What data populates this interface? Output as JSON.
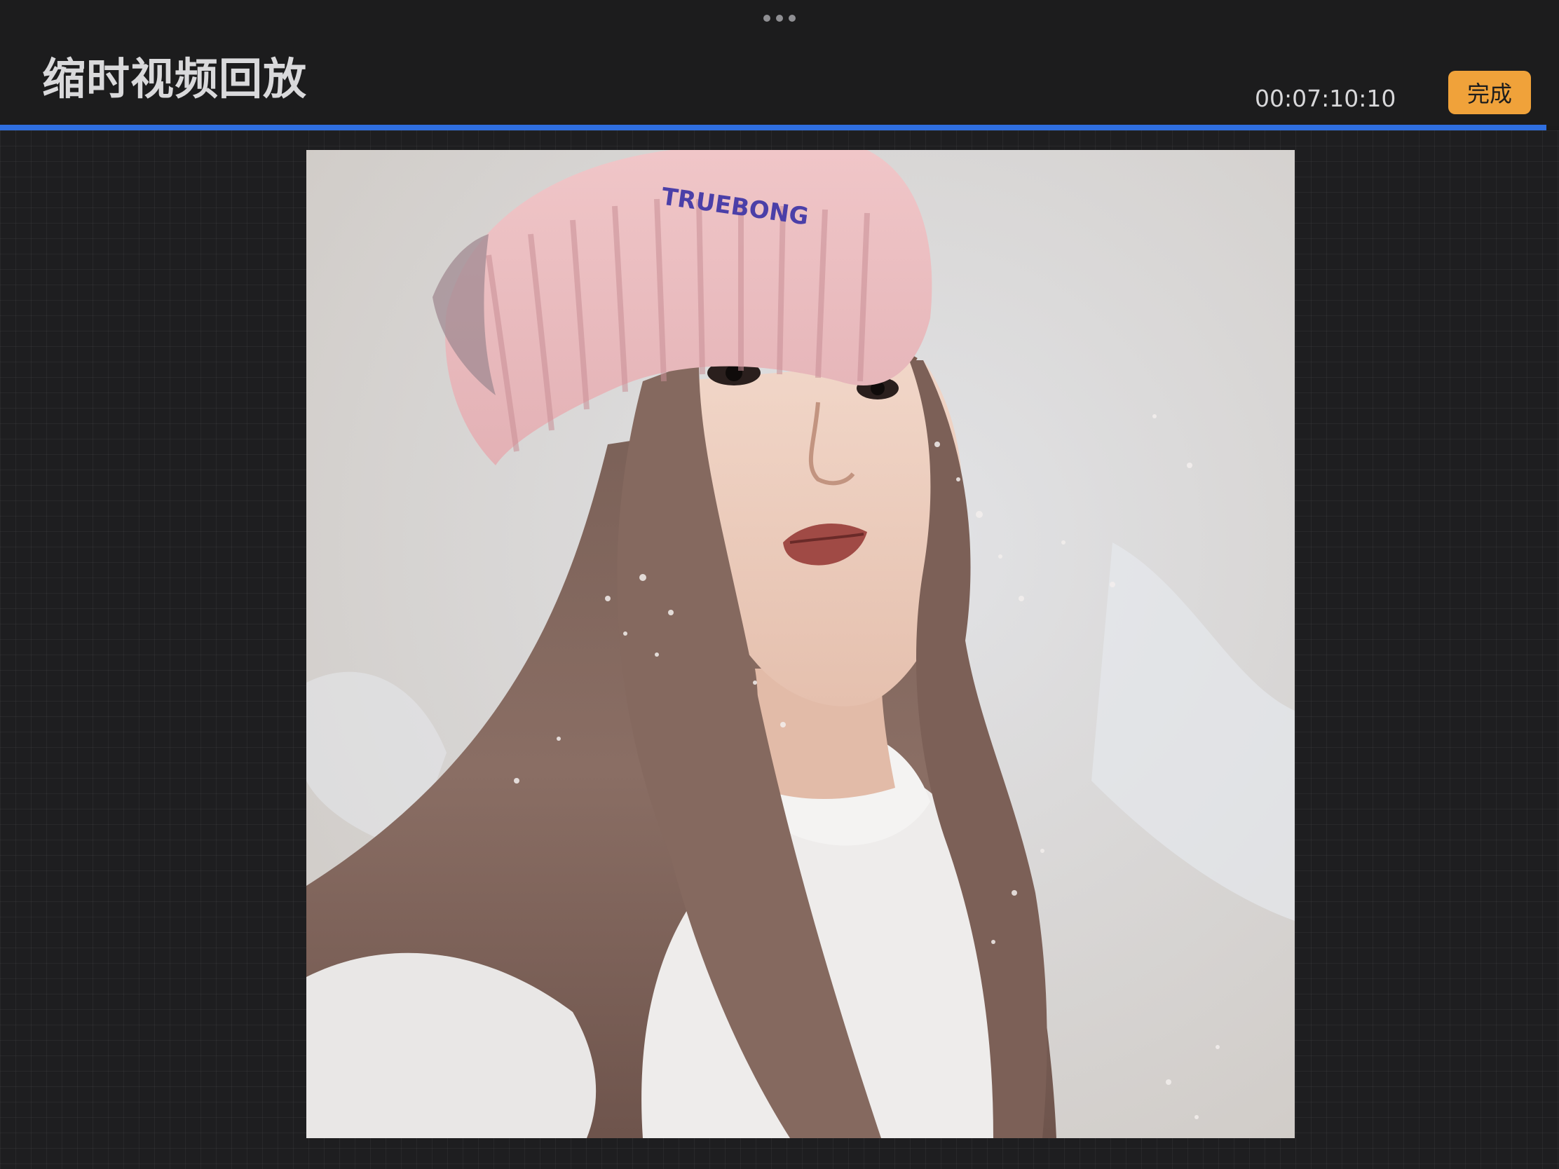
{
  "header": {
    "title": "缩时视频回放",
    "timecode": "00:07:10:10",
    "done_label": "完成"
  },
  "playback": {
    "progress": 1.0
  },
  "artwork": {
    "beanie_text": "TRUEBONG"
  },
  "icons": {
    "grabber": "more-dots-icon"
  },
  "colors": {
    "accent_button": "#f0a23a",
    "progress": "#2f6fe0",
    "background": "#1b1b1c"
  }
}
